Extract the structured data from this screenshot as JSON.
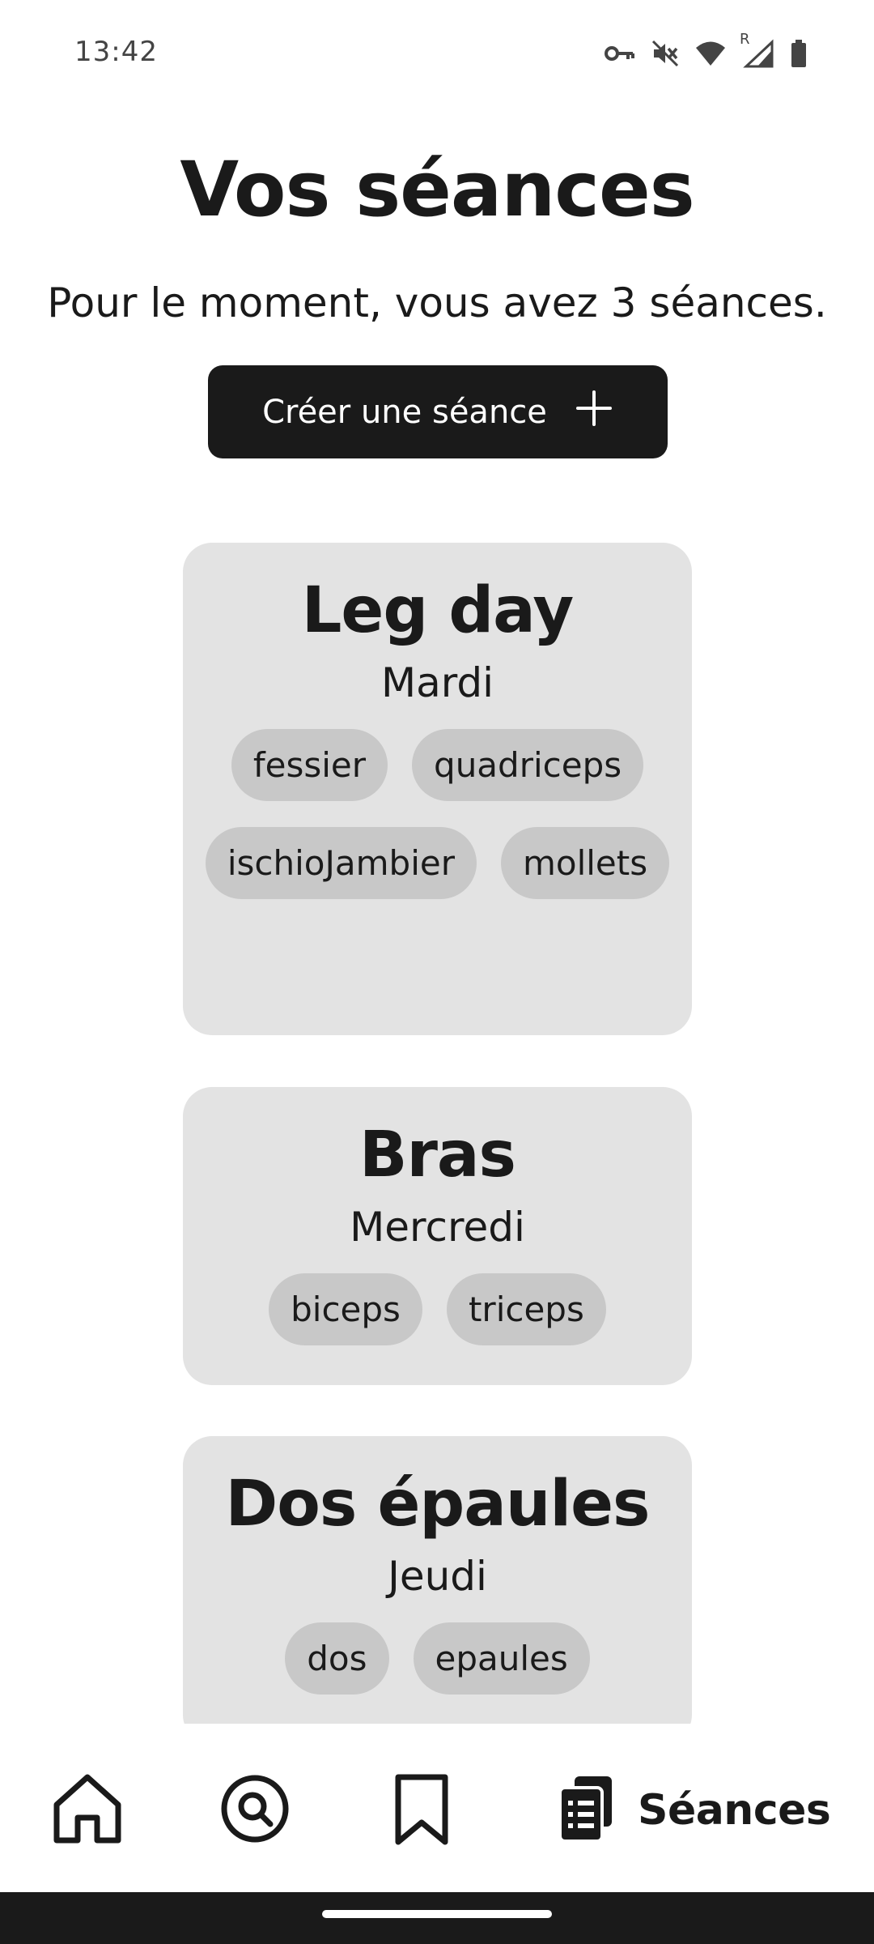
{
  "status_bar": {
    "time": "13:42",
    "icons": [
      "vpn-key-icon",
      "vibrate-off-icon",
      "wifi-icon",
      "signal-roaming-icon",
      "battery-icon"
    ],
    "roaming_label": "R"
  },
  "header": {
    "title": "Vos séances",
    "subtitle": "Pour le moment, vous avez 3 séances.",
    "create_button_label": "Créer une séance",
    "create_button_icon": "plus-icon"
  },
  "sessions": [
    {
      "title": "Leg day",
      "day": "Mardi",
      "tags": [
        "fessier",
        "quadriceps",
        "ischioJambier",
        "mollets"
      ]
    },
    {
      "title": "Bras",
      "day": "Mercredi",
      "tags": [
        "biceps",
        "triceps"
      ]
    },
    {
      "title": "Dos épaules",
      "day": "Jeudi",
      "tags": [
        "dos",
        "epaules"
      ]
    }
  ],
  "bottom_nav": {
    "items": [
      {
        "icon": "home-icon",
        "active": false
      },
      {
        "icon": "search-icon",
        "active": false
      },
      {
        "icon": "bookmark-icon",
        "active": false
      },
      {
        "icon": "sessions-clipboard-icon",
        "label": "Séances",
        "active": true
      }
    ]
  },
  "colors": {
    "background": "#ffffff",
    "text": "#1a1a1a",
    "button": "#1a1a1a",
    "card": "#e3e3e3",
    "tag": "#c8c8c8"
  }
}
